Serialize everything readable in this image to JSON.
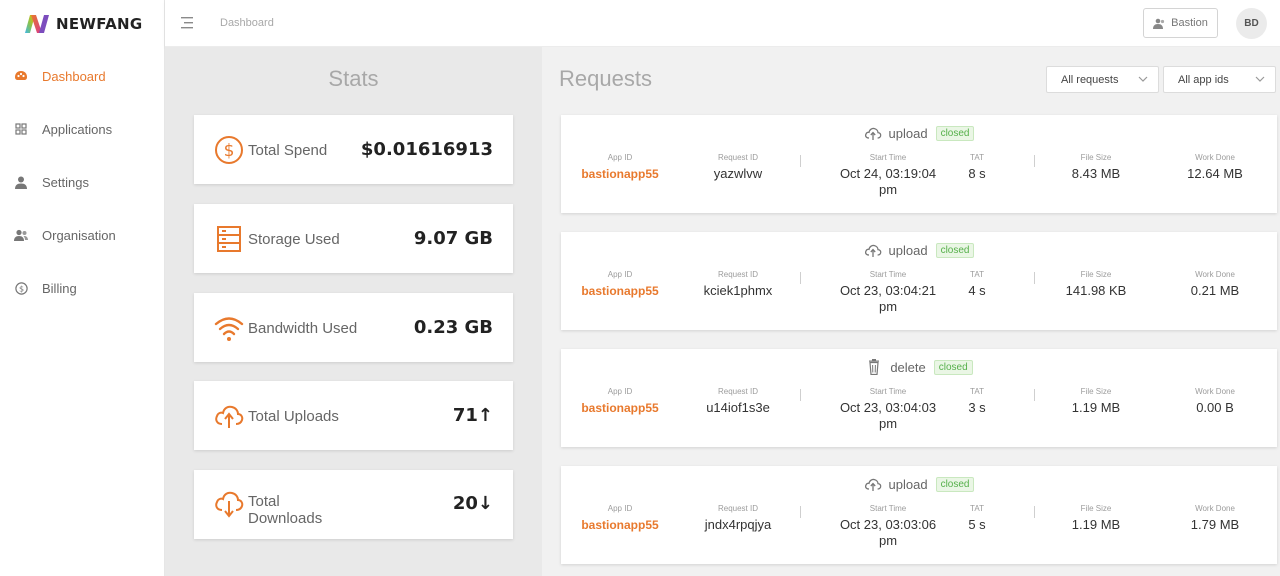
{
  "brand": {
    "name": "NEWFANG"
  },
  "sidebar": {
    "items": [
      {
        "label": "Dashboard",
        "icon": "palette-icon",
        "active": true
      },
      {
        "label": "Applications",
        "icon": "grid-icon",
        "active": false
      },
      {
        "label": "Settings",
        "icon": "user-icon",
        "active": false
      },
      {
        "label": "Organisation",
        "icon": "users-icon",
        "active": false
      },
      {
        "label": "Billing",
        "icon": "dollar-circle-icon",
        "active": false
      }
    ]
  },
  "topbar": {
    "breadcrumb": "Dashboard",
    "user_button_label": "Bastion",
    "avatar_initials": "BD"
  },
  "stats": {
    "title": "Stats",
    "cards": [
      {
        "label": "Total Spend",
        "value": "$0.01616913",
        "icon": "dollar-circle-icon"
      },
      {
        "label": "Storage Used",
        "value": "9.07 GB",
        "icon": "storage-icon"
      },
      {
        "label": "Bandwidth Used",
        "value": "0.23 GB",
        "icon": "wifi-icon"
      },
      {
        "label": "Total Uploads",
        "value": "71↑",
        "icon": "cloud-upload-icon"
      },
      {
        "label": "Total Downloads",
        "value": "20↓",
        "icon": "cloud-download-icon"
      }
    ]
  },
  "requests": {
    "title": "Requests",
    "filter_requests": "All requests",
    "filter_app_ids": "All app ids",
    "column_headers": {
      "app_id": "App ID",
      "request_id": "Request ID",
      "start_time": "Start Time",
      "tat": "TAT",
      "file_size": "File Size",
      "work_done": "Work Done"
    },
    "items": [
      {
        "type": "upload",
        "status": "closed",
        "app_id": "bastionapp55",
        "request_id": "yazwlvw",
        "start_time": "Oct 24, 03:19:04 pm",
        "tat": "8 s",
        "file_size": "8.43 MB",
        "work_done": "12.64 MB"
      },
      {
        "type": "upload",
        "status": "closed",
        "app_id": "bastionapp55",
        "request_id": "kciek1phmx",
        "start_time": "Oct 23, 03:04:21 pm",
        "tat": "4 s",
        "file_size": "141.98 KB",
        "work_done": "0.21 MB"
      },
      {
        "type": "delete",
        "status": "closed",
        "app_id": "bastionapp55",
        "request_id": "u14iof1s3e",
        "start_time": "Oct 23, 03:04:03 pm",
        "tat": "3 s",
        "file_size": "1.19 MB",
        "work_done": "0.00 B"
      },
      {
        "type": "upload",
        "status": "closed",
        "app_id": "bastionapp55",
        "request_id": "jndx4rpqjya",
        "start_time": "Oct 23, 03:03:06 pm",
        "tat": "5 s",
        "file_size": "1.19 MB",
        "work_done": "1.79 MB"
      }
    ]
  },
  "colors": {
    "accent": "#e8792d",
    "status_green": "#56b04b"
  }
}
